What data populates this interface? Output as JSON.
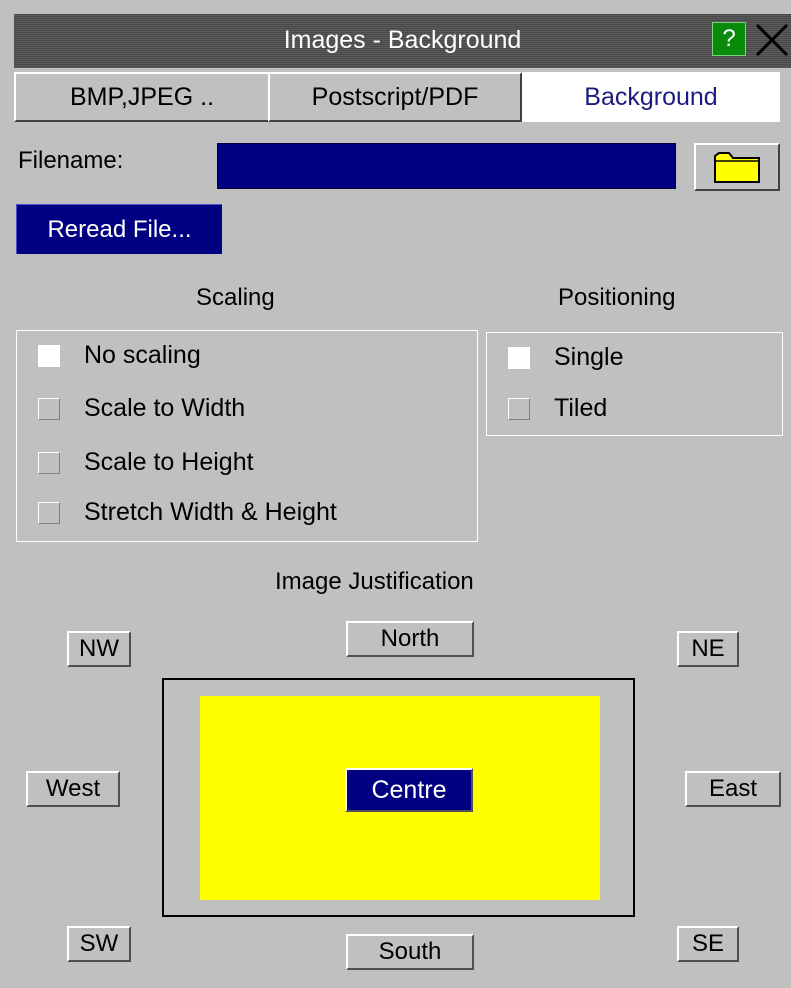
{
  "window": {
    "title": "Images - Background",
    "help_label": "?",
    "close_icon": "close-icon"
  },
  "tabs": [
    {
      "label": "BMP,JPEG ..",
      "active": false
    },
    {
      "label": "Postscript/PDF",
      "active": false
    },
    {
      "label": "Background",
      "active": true
    }
  ],
  "file": {
    "label": "Filename:",
    "value": "",
    "folder_icon": "folder-icon",
    "reread_label": "Reread File..."
  },
  "scaling": {
    "heading": "Scaling",
    "options": [
      {
        "label": "No scaling",
        "checked": true
      },
      {
        "label": "Scale to Width",
        "checked": false
      },
      {
        "label": "Scale to Height",
        "checked": false
      },
      {
        "label": "Stretch Width & Height",
        "checked": false
      }
    ]
  },
  "positioning": {
    "heading": "Positioning",
    "options": [
      {
        "label": "Single",
        "checked": true
      },
      {
        "label": "Tiled",
        "checked": false
      }
    ]
  },
  "justification": {
    "heading": "Image Justification",
    "nw": "NW",
    "north": "North",
    "ne": "NE",
    "west": "West",
    "centre": "Centre",
    "east": "East",
    "sw": "SW",
    "south": "South",
    "se": "SE",
    "selected": "Centre"
  },
  "colors": {
    "panel": "#c0c0c0",
    "field": "#000080",
    "preview": "#ffff00",
    "help": "#0a8a0a"
  }
}
